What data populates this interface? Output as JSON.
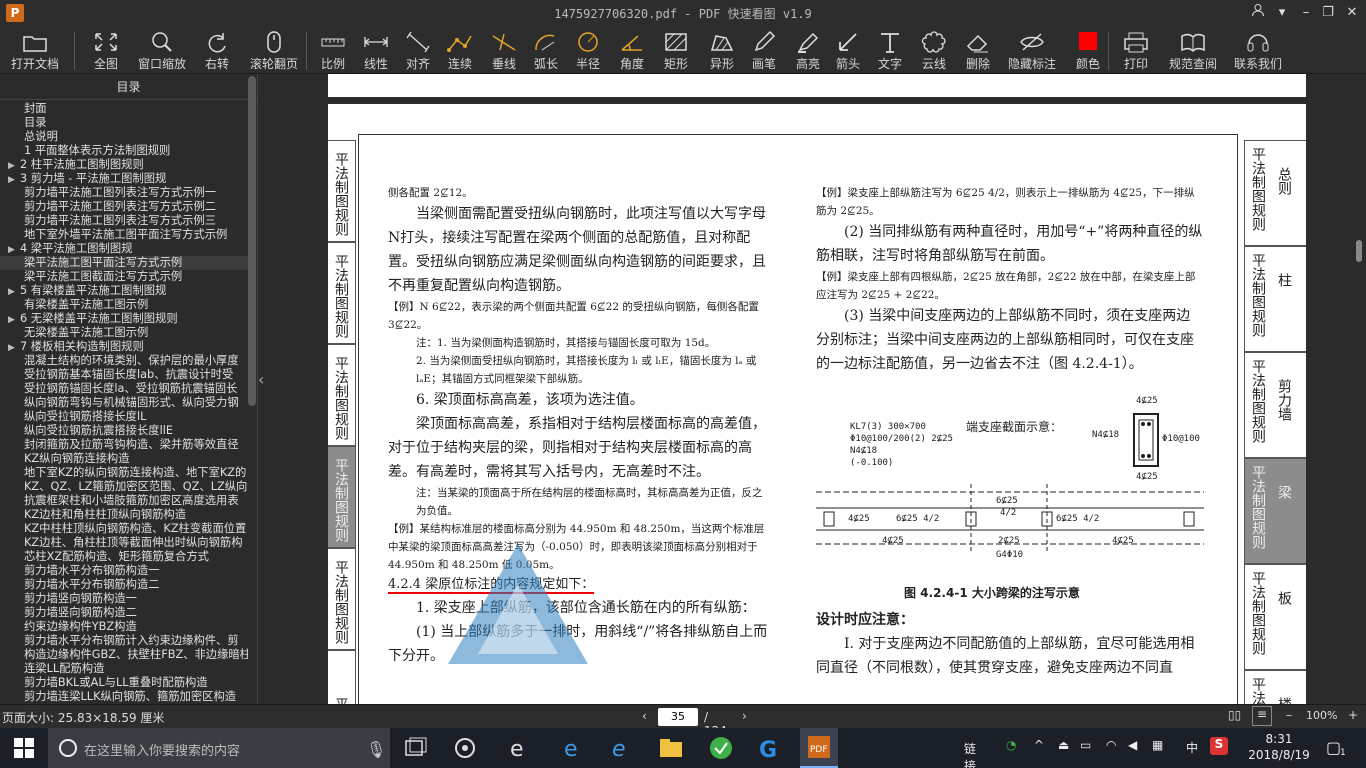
{
  "window": {
    "title": "1475927706320.pdf - PDF 快速看图 v1.9",
    "logo_text": "P"
  },
  "toolbar": [
    {
      "id": "open",
      "label": "打开文档",
      "icon": "folder-icon"
    },
    {
      "id": "fit",
      "label": "全图",
      "icon": "expand-icon"
    },
    {
      "id": "winzoom",
      "label": "窗口缩放",
      "icon": "magnifier-icon"
    },
    {
      "id": "rotate",
      "label": "右转",
      "icon": "rotate-icon"
    },
    {
      "id": "scroll",
      "label": "滚轮翻页",
      "icon": "mouse-icon"
    },
    {
      "id": "scale",
      "label": "比例",
      "icon": "ruler-icon"
    },
    {
      "id": "linear",
      "label": "线性",
      "icon": "linear-dim-icon"
    },
    {
      "id": "align",
      "label": "对齐",
      "icon": "aligned-dim-icon"
    },
    {
      "id": "cont",
      "label": "连续",
      "icon": "continuous-dim-icon"
    },
    {
      "id": "perp",
      "label": "垂线",
      "icon": "perpendicular-icon"
    },
    {
      "id": "arc",
      "label": "弧长",
      "icon": "arc-length-icon"
    },
    {
      "id": "radius",
      "label": "半径",
      "icon": "radius-icon"
    },
    {
      "id": "angle",
      "label": "角度",
      "icon": "angle-icon"
    },
    {
      "id": "rect",
      "label": "矩形",
      "icon": "rect-area-icon"
    },
    {
      "id": "poly",
      "label": "异形",
      "icon": "polygon-area-icon"
    },
    {
      "id": "pen",
      "label": "画笔",
      "icon": "pen-icon"
    },
    {
      "id": "hl",
      "label": "高亮",
      "icon": "highlighter-icon"
    },
    {
      "id": "arrow",
      "label": "箭头",
      "icon": "arrow-icon"
    },
    {
      "id": "text",
      "label": "文字",
      "icon": "text-icon"
    },
    {
      "id": "cloud",
      "label": "云线",
      "icon": "cloud-icon"
    },
    {
      "id": "del",
      "label": "删除",
      "icon": "eraser-icon"
    },
    {
      "id": "hide",
      "label": "隐藏标注",
      "icon": "eye-hidden-icon"
    },
    {
      "id": "color",
      "label": "颜色",
      "icon": "color-swatch-icon"
    },
    {
      "id": "print",
      "label": "打印",
      "icon": "printer-icon"
    },
    {
      "id": "spec",
      "label": "规范查阅",
      "icon": "book-icon"
    },
    {
      "id": "contact",
      "label": "联系我们",
      "icon": "headset-icon"
    }
  ],
  "accent_color": "#ff0000",
  "sidebar": {
    "title": "目录",
    "items": [
      {
        "t": "封面",
        "a": ""
      },
      {
        "t": "目录",
        "a": ""
      },
      {
        "t": "总说明",
        "a": ""
      },
      {
        "t": "1 平面整体表示方法制图规则",
        "a": ""
      },
      {
        "t": "2 柱平法施工图制图规则",
        "a": "▶"
      },
      {
        "t": "3 剪力墙 - 平法施工图制图规",
        "a": "▶"
      },
      {
        "t": "剪力墙平法施工图列表注写方式示例一",
        "a": ""
      },
      {
        "t": "剪力墙平法施工图列表注写方式示例二",
        "a": ""
      },
      {
        "t": "剪力墙平法施工图列表注写方式示例三",
        "a": ""
      },
      {
        "t": "地下室外墙平法施工图平面注写方式示例",
        "a": ""
      },
      {
        "t": "4 梁平法施工图制图规",
        "a": "▶"
      },
      {
        "t": "梁平法施工图平面注写方式示例",
        "a": "",
        "sel": true
      },
      {
        "t": "梁平法施工图截面注写方式示例",
        "a": ""
      },
      {
        "t": "5 有梁楼盖平法施工图制图规",
        "a": "▶"
      },
      {
        "t": "有梁楼盖平法施工图示例",
        "a": ""
      },
      {
        "t": "6 无梁楼盖平法施工图制图规则",
        "a": "▶"
      },
      {
        "t": "无梁楼盖平法施工图示例",
        "a": ""
      },
      {
        "t": "7 楼板相关构造制图规则",
        "a": "▶"
      },
      {
        "t": "混凝土结构的环境类别、保护层的最小厚度",
        "a": ""
      },
      {
        "t": "受拉钢筋基本锚固长度lab、抗震设计时受",
        "a": ""
      },
      {
        "t": "受拉钢筋锚固长度la、受拉钢筋抗震锚固长",
        "a": ""
      },
      {
        "t": "纵向钢筋弯钩与机械锚固形式、纵向受力钢",
        "a": ""
      },
      {
        "t": "纵向受拉钢筋搭接长度lL",
        "a": ""
      },
      {
        "t": "纵向受拉钢筋抗震搭接长度llE",
        "a": ""
      },
      {
        "t": "封闭箍筋及拉筋弯钩构造、梁并筋等效直径",
        "a": ""
      },
      {
        "t": "KZ纵向钢筋连接构造",
        "a": ""
      },
      {
        "t": "地下室KZ的纵向钢筋连接构造、地下室KZ的",
        "a": ""
      },
      {
        "t": "KZ、QZ、LZ箍筋加密区范围、QZ、LZ纵向钢",
        "a": ""
      },
      {
        "t": "抗震框架柱和小墙肢箍筋加密区高度选用表",
        "a": ""
      },
      {
        "t": "KZ边柱和角柱柱顶纵向钢筋构造",
        "a": ""
      },
      {
        "t": "KZ中柱柱顶纵向钢筋构造、KZ柱变截面位置",
        "a": ""
      },
      {
        "t": "KZ边柱、角柱柱顶等截面伸出时纵向钢筋构",
        "a": ""
      },
      {
        "t": "芯柱XZ配筋构造、矩形箍筋复合方式",
        "a": ""
      },
      {
        "t": "剪力墙水平分布钢筋构造一",
        "a": ""
      },
      {
        "t": "剪力墙水平分布钢筋构造二",
        "a": ""
      },
      {
        "t": "剪力墙竖向钢筋构造一",
        "a": ""
      },
      {
        "t": "剪力墙竖向钢筋构造二",
        "a": ""
      },
      {
        "t": "约束边缘构件YBZ构造",
        "a": ""
      },
      {
        "t": "剪力墙水平分布钢筋计入约束边缘构件、剪",
        "a": ""
      },
      {
        "t": "构造边缘构件GBZ、扶壁柱FBZ、非边缘暗柱",
        "a": ""
      },
      {
        "t": "连梁LL配筋构造",
        "a": ""
      },
      {
        "t": "剪力墙BKL或AL与LL重叠时配筋构造",
        "a": ""
      },
      {
        "t": "剪力墙连梁LLK纵向钢筋、箍筋加密区构造",
        "a": ""
      }
    ]
  },
  "document": {
    "left_tabs": [
      "平法制图规则",
      "平法制图规则",
      "平法制图规则",
      "平法制图规则",
      "平法制图规则",
      "平"
    ],
    "left_tab_active": 3,
    "right_tabs": [
      {
        "v": "平法制图规则",
        "s": "总则"
      },
      {
        "v": "平法制图规则",
        "s": "柱"
      },
      {
        "v": "平法制图规则",
        "s": "剪力墙"
      },
      {
        "v": "平法制图规则",
        "s": "梁"
      },
      {
        "v": "平法制图规则",
        "s": "板"
      },
      {
        "v": "平法",
        "s": "楼板"
      }
    ],
    "right_tab_active": 3,
    "left_col": [
      {
        "k": "ex",
        "t": "侧各配置 2⊈12。"
      },
      {
        "k": "p",
        "t": "当梁侧面需配置受扭纵向钢筋时，此项注写值以大写字母N打头，接续注写配置在梁两个侧面的总配筋值，且对称配置。受扭纵向钢筋应满足梁侧面纵向构造钢筋的间距要求，且不再重复配置纵向构造钢筋。"
      },
      {
        "k": "ex",
        "t": "【例】N 6⊈22，表示梁的两个侧面共配置 6⊈22 的受扭纵向钢筋，每侧各配置 3⊈22。"
      },
      {
        "k": "note",
        "t": "注：1. 当为梁侧面构造钢筋时，其搭接与锚固长度可取为 15d。"
      },
      {
        "k": "note",
        "t": "2. 当为梁侧面受扭纵向钢筋时，其搭接长度为 lₗ 或 lₗE，锚固长度为 lₐ 或 lₐE；其锚固方式同框架梁下部纵筋。"
      },
      {
        "k": "p",
        "t": "6. 梁顶面标高高差，该项为选注值。"
      },
      {
        "k": "p",
        "t": "梁顶面标高高差，系指相对于结构层楼面标高的高差值，对于位于结构夹层的梁，则指相对于结构夹层楼面标高的高差。有高差时，需将其写入括号内，无高差时不注。"
      },
      {
        "k": "note",
        "t": "注：当某梁的顶面高于所在结构层的楼面标高时，其标高高差为正值，反之为负值。"
      },
      {
        "k": "ex",
        "t": "【例】某结构标准层的楼面标高分别为 44.950m 和 48.250m，当这两个标准层中某梁的梁顶面标高高差注写为（-0.050）时，即表明该梁顶面标高分别相对于 44.950m 和 48.250m 低 0.05m。"
      },
      {
        "k": "h",
        "t": "4.2.4  梁原位标注的内容规定如下："
      },
      {
        "k": "p",
        "t": "1. 梁支座上部纵筋，该部位含通长筋在内的所有纵筋："
      },
      {
        "k": "p",
        "t": "(1) 当上部纵筋多于一排时，用斜线“/”将各排纵筋自上而下分开。"
      }
    ],
    "right_col": [
      {
        "k": "ex",
        "t": "【例】梁支座上部纵筋注写为 6⊈25 4/2，则表示上一排纵筋为 4⊈25，下一排纵筋为 2⊈25。"
      },
      {
        "k": "p",
        "t": "(2) 当同排纵筋有两种直径时，用加号“+”将两种直径的纵筋相联，注写时将角部纵筋写在前面。"
      },
      {
        "k": "ex",
        "t": "【例】梁支座上部有四根纵筋，2⊈25 放在角部，2⊈22 放在中部，在梁支座上部应注写为 2⊈25 + 2⊈22。"
      },
      {
        "k": "p",
        "t": "(3) 当梁中间支座两边的上部纵筋不同时，须在支座两边分别标注；当梁中间支座两边的上部纵筋相同时，可仅在支座的一边标注配筋值，另一边省去不注（图 4.2.4-1）。"
      }
    ],
    "figure": {
      "caption": "图 4.2.4-1  大小跨梁的注写示意",
      "section_label": "端支座截面示意：",
      "kl_lines": [
        "KL7(3)  300×700",
        "Φ10@100/200(2)  2⊈25",
        "N4⊈18",
        "(-0.100)"
      ],
      "labels": [
        "4⊈25",
        "N4⊈18",
        "Φ10@100",
        "4⊈25",
        "6⊈25",
        "4/2",
        "6⊈25 4/2",
        "4⊈25",
        "6⊈25 4/2",
        "4⊈25",
        "2⊈25",
        "G4Φ10",
        "4⊈25"
      ]
    },
    "bottom_col": [
      {
        "k": "hb",
        "t": "设计时应注意："
      },
      {
        "k": "p",
        "t": "Ⅰ. 对于支座两边不同配筋值的上部纵筋，宜尽可能选用相同直径（不同根数），使其贯穿支座，避免支座两边不同直"
      }
    ]
  },
  "status": {
    "page_size": "页面大小: 25.83×18.59 厘米",
    "current_page": "35",
    "total_pages": "/ 124",
    "zoom": "100%"
  },
  "taskbar": {
    "search_placeholder": "在这里输入你要搜索的内容",
    "tray_label": "链接",
    "ime": "中",
    "time": "8:31",
    "date": "2018/8/19",
    "notify_count": "1"
  }
}
